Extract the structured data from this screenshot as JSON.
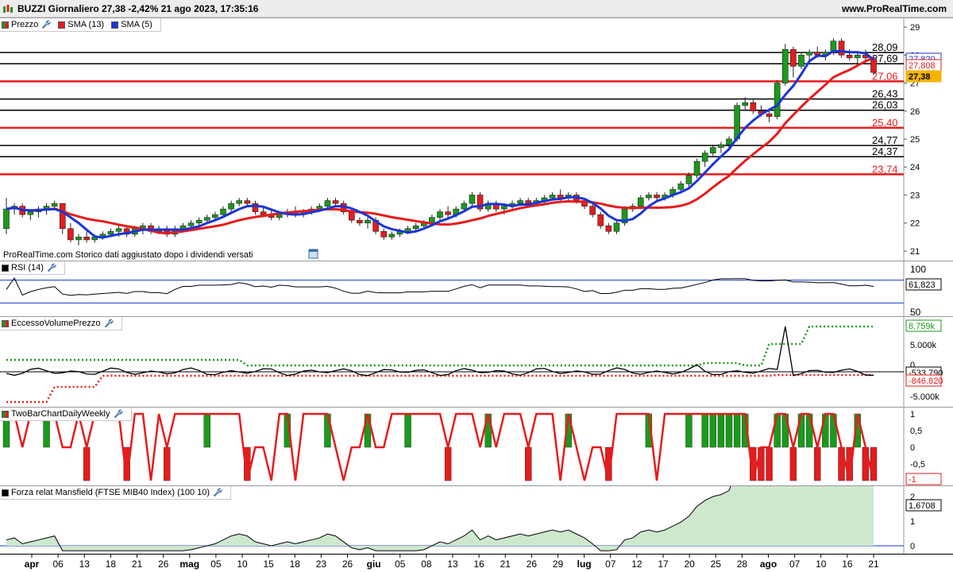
{
  "header": {
    "title": "BUZZI Giornaliero 27,38 -2,42% 21 ago 2023, 17:35:16",
    "site": "www.ProRealTime.com"
  },
  "price_pane": {
    "legend": [
      {
        "label": "Prezzo",
        "color": "#1a9a1a"
      },
      {
        "label": "SMA (13)",
        "color": "#e51c1c"
      },
      {
        "label": "SMA (5)",
        "color": "#1a35d6"
      }
    ],
    "watermark": "ProRealTime.com Storico dati aggiustato dopo i dividendi versati",
    "y_ticks": [
      "29",
      "28",
      "27",
      "26",
      "25",
      "24",
      "23",
      "22",
      "21"
    ],
    "h_lines": [
      {
        "label": "28,09",
        "color": "#000000"
      },
      {
        "label": "27,69",
        "color": "#000000"
      },
      {
        "label": "27,06",
        "color": "#e51c1c"
      },
      {
        "label": "26,43",
        "color": "#000000"
      },
      {
        "label": "26,03",
        "color": "#000000"
      },
      {
        "label": "25,40",
        "color": "#e51c1c"
      },
      {
        "label": "24,77",
        "color": "#000000"
      },
      {
        "label": "24,37",
        "color": "#000000"
      },
      {
        "label": "23,74",
        "color": "#e51c1c"
      }
    ],
    "badges": [
      {
        "label": "27,820",
        "color": "#1a35d6"
      },
      {
        "label": "27,808",
        "color": "#e51c1c"
      },
      {
        "label": "27,38",
        "color": "#f5b400"
      }
    ]
  },
  "rsi_pane": {
    "legend": "RSI (14)",
    "y_ticks": [
      "100",
      "50"
    ],
    "badge": "61,823"
  },
  "eccesso_pane": {
    "legend": "EccessoVolumePrezzo",
    "y_ticks": [
      "5.000k",
      "0",
      "-5.000k"
    ],
    "badges": [
      {
        "label": "8.759k",
        "color": "#1a9a1a"
      },
      {
        "label": "-533.790",
        "color": "#000000"
      },
      {
        "label": "-846.820",
        "color": "#e51c1c"
      }
    ]
  },
  "twobar_pane": {
    "legend": "TwoBarChartDailyWeekly",
    "y_ticks": [
      "1",
      "0,5",
      "0",
      "-0,5"
    ],
    "badge": "-1"
  },
  "mansfield_pane": {
    "legend": "Forza relat Mansfield (FTSE MIB40 Index) (100 10)",
    "y_ticks": [
      "2",
      "1",
      "0"
    ],
    "badge": "1,6708"
  },
  "x_axis": {
    "labels": [
      "apr",
      "06",
      "13",
      "18",
      "21",
      "26",
      "mag",
      "05",
      "10",
      "15",
      "18",
      "23",
      "26",
      "giu",
      "05",
      "08",
      "13",
      "16",
      "21",
      "26",
      "29",
      "lug",
      "07",
      "12",
      "17",
      "20",
      "25",
      "28",
      "ago",
      "07",
      "10",
      "16",
      "21"
    ],
    "bold_labels": [
      "apr",
      "mag",
      "giu",
      "lug",
      "ago"
    ]
  },
  "chart_data": {
    "type": "candlestick",
    "symbol": "BUZZI",
    "period": "Giornaliero",
    "ylim": [
      20.8,
      29.2
    ],
    "series": [
      {
        "name": "SMA (13)",
        "color": "#e51c1c"
      },
      {
        "name": "SMA (5)",
        "color": "#1a35d6"
      }
    ],
    "ohlc": [
      [
        21.8,
        22.9,
        21.6,
        22.5
      ],
      [
        22.5,
        22.7,
        22.3,
        22.6
      ],
      [
        22.6,
        22.7,
        22.2,
        22.3
      ],
      [
        22.3,
        22.5,
        22.1,
        22.4
      ],
      [
        22.4,
        22.6,
        22.2,
        22.5
      ],
      [
        22.5,
        22.7,
        22.3,
        22.6
      ],
      [
        22.6,
        22.8,
        22.5,
        22.7
      ],
      [
        22.7,
        22.7,
        21.6,
        21.8
      ],
      [
        21.8,
        22.0,
        21.3,
        21.4
      ],
      [
        21.4,
        21.6,
        21.2,
        21.5
      ],
      [
        21.5,
        21.7,
        21.3,
        21.4
      ],
      [
        21.4,
        21.6,
        21.3,
        21.5
      ],
      [
        21.5,
        21.7,
        21.4,
        21.6
      ],
      [
        21.6,
        21.8,
        21.5,
        21.7
      ],
      [
        21.7,
        21.9,
        21.5,
        21.8
      ],
      [
        21.8,
        21.9,
        21.5,
        21.6
      ],
      [
        21.6,
        21.9,
        21.5,
        21.8
      ],
      [
        21.8,
        22.0,
        21.6,
        21.9
      ],
      [
        21.9,
        22.0,
        21.6,
        21.7
      ],
      [
        21.7,
        21.9,
        21.6,
        21.8
      ],
      [
        21.8,
        21.9,
        21.5,
        21.6
      ],
      [
        21.6,
        21.9,
        21.5,
        21.8
      ],
      [
        21.8,
        22.0,
        21.7,
        21.9
      ],
      [
        21.9,
        22.1,
        21.8,
        22.0
      ],
      [
        22.0,
        22.2,
        21.9,
        22.1
      ],
      [
        22.1,
        22.3,
        22.0,
        22.2
      ],
      [
        22.2,
        22.4,
        22.1,
        22.3
      ],
      [
        22.3,
        22.6,
        22.2,
        22.5
      ],
      [
        22.5,
        22.8,
        22.4,
        22.7
      ],
      [
        22.7,
        22.9,
        22.6,
        22.8
      ],
      [
        22.8,
        22.9,
        22.6,
        22.7
      ],
      [
        22.7,
        22.8,
        22.3,
        22.4
      ],
      [
        22.4,
        22.6,
        22.2,
        22.3
      ],
      [
        22.3,
        22.5,
        22.1,
        22.2
      ],
      [
        22.2,
        22.4,
        22.1,
        22.3
      ],
      [
        22.3,
        22.5,
        22.2,
        22.4
      ],
      [
        22.4,
        22.6,
        22.2,
        22.3
      ],
      [
        22.3,
        22.5,
        22.2,
        22.4
      ],
      [
        22.4,
        22.6,
        22.3,
        22.5
      ],
      [
        22.5,
        22.7,
        22.4,
        22.6
      ],
      [
        22.6,
        22.9,
        22.5,
        22.8
      ],
      [
        22.8,
        22.9,
        22.6,
        22.7
      ],
      [
        22.7,
        22.8,
        22.3,
        22.4
      ],
      [
        22.4,
        22.5,
        22.0,
        22.1
      ],
      [
        22.1,
        22.2,
        21.9,
        22.0
      ],
      [
        22.0,
        22.2,
        21.8,
        22.1
      ],
      [
        22.1,
        22.2,
        21.6,
        21.7
      ],
      [
        21.7,
        21.8,
        21.4,
        21.5
      ],
      [
        21.5,
        21.7,
        21.4,
        21.6
      ],
      [
        21.6,
        21.8,
        21.5,
        21.7
      ],
      [
        21.7,
        21.9,
        21.6,
        21.8
      ],
      [
        21.8,
        22.0,
        21.7,
        21.9
      ],
      [
        21.9,
        22.1,
        21.8,
        22.0
      ],
      [
        22.0,
        22.3,
        21.9,
        22.2
      ],
      [
        22.2,
        22.5,
        22.1,
        22.4
      ],
      [
        22.4,
        22.6,
        22.2,
        22.3
      ],
      [
        22.3,
        22.6,
        22.2,
        22.5
      ],
      [
        22.5,
        22.8,
        22.4,
        22.7
      ],
      [
        22.7,
        23.1,
        22.6,
        23.0
      ],
      [
        23.0,
        23.1,
        22.4,
        22.5
      ],
      [
        22.5,
        22.8,
        22.4,
        22.7
      ],
      [
        22.7,
        22.8,
        22.4,
        22.5
      ],
      [
        22.5,
        22.7,
        22.3,
        22.6
      ],
      [
        22.6,
        22.8,
        22.5,
        22.7
      ],
      [
        22.7,
        22.9,
        22.6,
        22.8
      ],
      [
        22.8,
        22.9,
        22.6,
        22.7
      ],
      [
        22.7,
        22.9,
        22.6,
        22.8
      ],
      [
        22.8,
        23.0,
        22.7,
        22.9
      ],
      [
        22.9,
        23.1,
        22.8,
        23.0
      ],
      [
        23.0,
        23.2,
        22.8,
        22.9
      ],
      [
        22.9,
        23.1,
        22.8,
        23.0
      ],
      [
        23.0,
        23.1,
        22.7,
        22.8
      ],
      [
        22.8,
        22.9,
        22.5,
        22.6
      ],
      [
        22.6,
        22.7,
        22.2,
        22.3
      ],
      [
        22.3,
        22.4,
        21.8,
        21.9
      ],
      [
        21.9,
        22.0,
        21.6,
        21.7
      ],
      [
        21.7,
        22.1,
        21.6,
        22.0
      ],
      [
        22.0,
        22.6,
        21.9,
        22.5
      ],
      [
        22.5,
        22.7,
        22.4,
        22.6
      ],
      [
        22.6,
        23.0,
        22.5,
        22.9
      ],
      [
        22.9,
        23.1,
        22.8,
        23.0
      ],
      [
        23.0,
        23.1,
        22.8,
        22.9
      ],
      [
        22.9,
        23.1,
        22.8,
        23.0
      ],
      [
        23.0,
        23.3,
        22.9,
        23.2
      ],
      [
        23.2,
        23.5,
        23.1,
        23.4
      ],
      [
        23.4,
        23.8,
        23.3,
        23.7
      ],
      [
        23.7,
        24.3,
        23.6,
        24.2
      ],
      [
        24.2,
        24.6,
        24.0,
        24.5
      ],
      [
        24.5,
        24.8,
        24.4,
        24.7
      ],
      [
        24.7,
        24.9,
        24.5,
        24.8
      ],
      [
        24.8,
        25.1,
        24.7,
        25.0
      ],
      [
        25.0,
        26.3,
        24.9,
        26.2
      ],
      [
        26.2,
        26.5,
        26.0,
        26.3
      ],
      [
        26.3,
        26.4,
        25.9,
        26.0
      ],
      [
        26.0,
        26.2,
        25.8,
        25.9
      ],
      [
        25.9,
        26.1,
        25.6,
        25.8
      ],
      [
        25.8,
        27.1,
        25.7,
        27.0
      ],
      [
        27.0,
        28.4,
        26.9,
        28.2
      ],
      [
        28.2,
        28.3,
        27.2,
        27.6
      ],
      [
        27.6,
        28.1,
        27.5,
        28.0
      ],
      [
        28.0,
        28.2,
        27.8,
        28.1
      ],
      [
        28.1,
        28.3,
        27.9,
        28.0
      ],
      [
        28.0,
        28.2,
        27.8,
        28.1
      ],
      [
        28.1,
        28.6,
        28.0,
        28.5
      ],
      [
        28.5,
        28.6,
        27.9,
        28.0
      ],
      [
        28.0,
        28.2,
        27.8,
        27.9
      ],
      [
        27.9,
        28.1,
        27.7,
        28.0
      ],
      [
        28.0,
        28.2,
        27.8,
        27.9
      ],
      [
        27.9,
        28.0,
        27.3,
        27.38
      ]
    ]
  }
}
